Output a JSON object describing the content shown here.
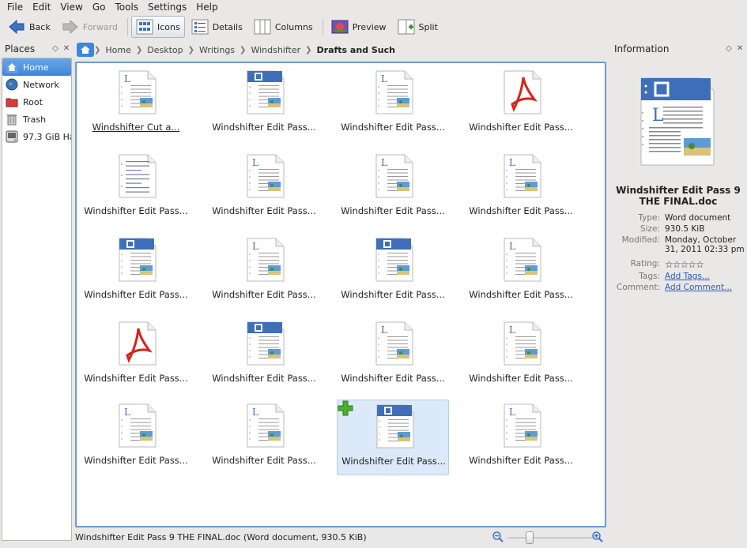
{
  "menu": [
    "File",
    "Edit",
    "View",
    "Go",
    "Tools",
    "Settings",
    "Help"
  ],
  "toolbar": {
    "back": "Back",
    "forward": "Forward",
    "icons": "Icons",
    "details": "Details",
    "columns": "Columns",
    "preview": "Preview",
    "split": "Split"
  },
  "places": {
    "title": "Places",
    "items": [
      {
        "label": "Home"
      },
      {
        "label": "Network"
      },
      {
        "label": "Root"
      },
      {
        "label": "Trash"
      },
      {
        "label": "97.3 GiB Ha..."
      }
    ]
  },
  "breadcrumb": [
    "Home",
    "Desktop",
    "Writings",
    "Windshifter",
    "Drafts and Such"
  ],
  "files": [
    {
      "name": "Windshifter Cut a...",
      "type": "doc"
    },
    {
      "name": "Windshifter Edit Pass...",
      "type": "blue"
    },
    {
      "name": "Windshifter Edit Pass...",
      "type": "doc"
    },
    {
      "name": "Windshifter Edit Pass...",
      "type": "pdf"
    },
    {
      "name": "Windshifter Edit Pass...",
      "type": "text"
    },
    {
      "name": "Windshifter Edit Pass...",
      "type": "doc"
    },
    {
      "name": "Windshifter Edit Pass...",
      "type": "doc"
    },
    {
      "name": "Windshifter Edit Pass...",
      "type": "doc"
    },
    {
      "name": "Windshifter Edit Pass...",
      "type": "blue"
    },
    {
      "name": "Windshifter Edit Pass...",
      "type": "doc"
    },
    {
      "name": "Windshifter Edit Pass...",
      "type": "blue"
    },
    {
      "name": "Windshifter Edit Pass...",
      "type": "doc"
    },
    {
      "name": "Windshifter Edit Pass...",
      "type": "pdf"
    },
    {
      "name": "Windshifter Edit Pass...",
      "type": "blue"
    },
    {
      "name": "Windshifter Edit Pass...",
      "type": "doc"
    },
    {
      "name": "Windshifter Edit Pass...",
      "type": "doc"
    },
    {
      "name": "Windshifter Edit Pass...",
      "type": "doc"
    },
    {
      "name": "Windshifter Edit Pass...",
      "type": "doc"
    },
    {
      "name": "Windshifter Edit Pass...",
      "type": "blue"
    },
    {
      "name": "Windshifter Edit Pass...",
      "type": "doc"
    }
  ],
  "status": "Windshifter Edit Pass 9 THE FINAL.doc (Word document, 930.5 KiB)",
  "info": {
    "title": "Information",
    "filename": "Windshifter Edit Pass 9 THE FINAL.doc",
    "type_label": "Type:",
    "type": "Word document",
    "size_label": "Size:",
    "size": "930.5 KiB",
    "modified_label": "Modified:",
    "modified": "Monday, October 31, 2011 02:33 pm",
    "rating_label": "Rating:",
    "rating": 0,
    "tags_label": "Tags:",
    "tags": "Add Tags...",
    "comment_label": "Comment:",
    "comment": "Add Comment..."
  },
  "colors": {
    "accent": "#3f86d8",
    "selection": "#dbe9f8",
    "pdf": "#d9221c"
  }
}
